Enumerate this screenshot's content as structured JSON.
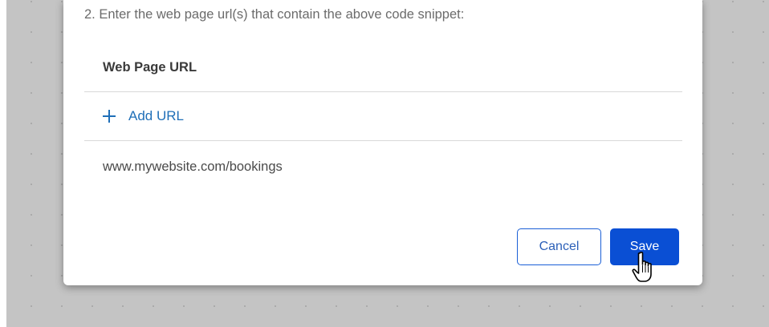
{
  "dialog": {
    "instruction": "2. Enter the web page url(s) that contain the above code snippet:",
    "column_header": "Web Page URL",
    "add_url_label": "Add URL",
    "urls": [
      "www.mywebsite.com/bookings"
    ],
    "cancel_label": "Cancel",
    "save_label": "Save"
  },
  "icons": {
    "add": "plus-icon",
    "pointer": "hand-cursor-icon"
  },
  "colors": {
    "link": "#1f6fb8",
    "primary_button": "#0a4fd4",
    "backdrop": "#c4c4c4"
  }
}
